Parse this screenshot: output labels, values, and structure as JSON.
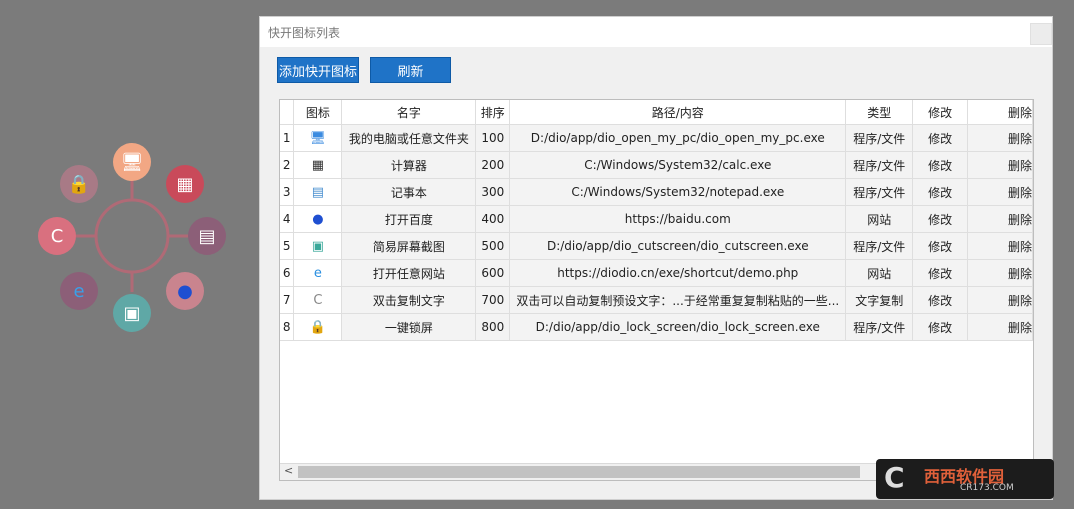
{
  "dialog": {
    "title": "快开图标列表",
    "add_label": "添加快开图标",
    "refresh_label": "刷新"
  },
  "table": {
    "headers": [
      "图标",
      "名字",
      "排序",
      "路径/内容",
      "类型",
      "修改",
      "删除"
    ],
    "rows": [
      {
        "num": "1",
        "icon": "computer-icon",
        "name": "我的电脑或任意文件夹",
        "order": "100",
        "path": "D:/dio/app/dio_open_my_pc/dio_open_my_pc.exe",
        "type": "程序/文件",
        "edit": "修改",
        "del": "删除"
      },
      {
        "num": "2",
        "icon": "calculator-icon",
        "name": "计算器",
        "order": "200",
        "path": "C:/Windows/System32/calc.exe",
        "type": "程序/文件",
        "edit": "修改",
        "del": "删除"
      },
      {
        "num": "3",
        "icon": "notepad-icon",
        "name": "记事本",
        "order": "300",
        "path": "C:/Windows/System32/notepad.exe",
        "type": "程序/文件",
        "edit": "修改",
        "del": "删除"
      },
      {
        "num": "4",
        "icon": "baidu-icon",
        "name": "打开百度",
        "order": "400",
        "path": "https://baidu.com",
        "type": "网站",
        "edit": "修改",
        "del": "删除"
      },
      {
        "num": "5",
        "icon": "screenshot-icon",
        "name": "简易屏幕截图",
        "order": "500",
        "path": "D:/dio/app/dio_cutscreen/dio_cutscreen.exe",
        "type": "程序/文件",
        "edit": "修改",
        "del": "删除"
      },
      {
        "num": "6",
        "icon": "ie-icon",
        "name": "打开任意网站",
        "order": "600",
        "path": "https://diodio.cn/exe/shortcut/demo.php",
        "type": "网站",
        "edit": "修改",
        "del": "删除"
      },
      {
        "num": "7",
        "icon": "copy-text-icon",
        "name": "双击复制文字",
        "order": "700",
        "path": "双击可以自动复制预设文字：...于经常重复复制粘贴的一些...",
        "type": "文字复制",
        "edit": "修改",
        "del": "删除"
      },
      {
        "num": "8",
        "icon": "lock-icon",
        "name": "一键锁屏",
        "order": "800",
        "path": "D:/dio/app/dio_lock_screen/dio_lock_screen.exe",
        "type": "程序/文件",
        "edit": "修改",
        "del": "删除"
      }
    ],
    "scroll_left_arrow": "<"
  },
  "launcher": {
    "items": [
      {
        "icon": "computer-icon",
        "color": "#f2a784"
      },
      {
        "icon": "calculator-icon",
        "color": "#c94a5a"
      },
      {
        "icon": "notepad-icon",
        "color": "#8c5f78"
      },
      {
        "icon": "baidu-icon",
        "color": "#c9848e"
      },
      {
        "icon": "screenshot-icon",
        "color": "#5fa8a6"
      },
      {
        "icon": "ie-icon",
        "color": "#8c5f78"
      },
      {
        "icon": "copy-text-icon",
        "color": "#d9707f"
      },
      {
        "icon": "lock-icon",
        "color": "#a87a86"
      }
    ]
  },
  "watermark": {
    "text": "西西软件园",
    "sub": "CR173.COM"
  }
}
